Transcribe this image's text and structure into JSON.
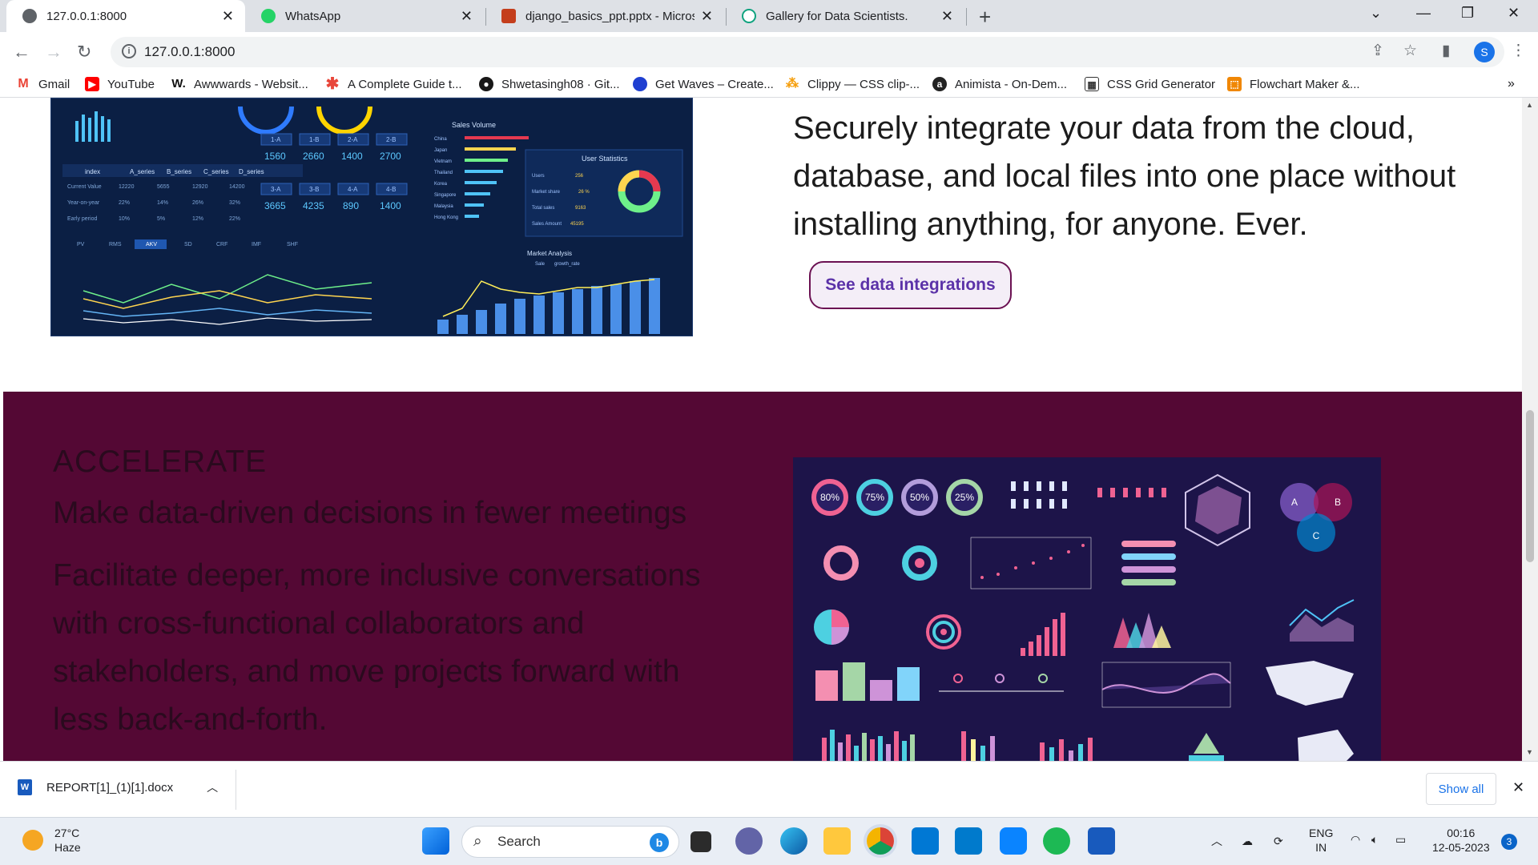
{
  "browser": {
    "tabs": [
      {
        "title": "127.0.0.1:8000",
        "active": true,
        "icon": "globe-icon"
      },
      {
        "title": "WhatsApp",
        "active": false,
        "icon": "whatsapp-icon"
      },
      {
        "title": "django_basics_ppt.pptx - Microsc",
        "active": false,
        "icon": "powerpoint-icon"
      },
      {
        "title": "Gallery for Data Scientists.",
        "active": false,
        "icon": "openai-icon"
      }
    ],
    "url": "127.0.0.1:8000",
    "profile_initial": "S",
    "bookmarks": [
      {
        "label": "Gmail",
        "icon": "gmail-icon"
      },
      {
        "label": "YouTube",
        "icon": "youtube-icon"
      },
      {
        "label": "Awwwards - Websit...",
        "icon": "awwwards-icon"
      },
      {
        "label": "A Complete Guide t...",
        "icon": "asterisk-icon"
      },
      {
        "label": "Shwetasingh08 · Git...",
        "icon": "github-icon"
      },
      {
        "label": "Get Waves – Create...",
        "icon": "waves-icon"
      },
      {
        "label": "Clippy — CSS clip-...",
        "icon": "clippy-icon"
      },
      {
        "label": "Animista - On-Dem...",
        "icon": "animista-icon"
      },
      {
        "label": "CSS Grid Generator",
        "icon": "grid-icon"
      },
      {
        "label": "Flowchart Maker &...",
        "icon": "flowchart-icon"
      }
    ]
  },
  "page": {
    "hero_text": "Securely integrate your data from the cloud, database, and local files into one place without installing anything, for anyone. Ever.",
    "cta_label": "See data integrations",
    "dashboard1": {
      "table_headers": [
        "index",
        "A_series",
        "B_series",
        "C_series",
        "D_series"
      ],
      "table_rows": [
        [
          "Current Value",
          "12220",
          "5655",
          "12920",
          "14200"
        ],
        [
          "Year-on-year",
          "22%",
          "14%",
          "26%",
          "32%"
        ],
        [
          "Early period",
          "10%",
          "5%",
          "12%",
          "22%"
        ]
      ],
      "tiles": [
        {
          "label": "1-A",
          "value": "1560"
        },
        {
          "label": "1-B",
          "value": "2660"
        },
        {
          "label": "2-A",
          "value": "1400"
        },
        {
          "label": "2-B",
          "value": "2700"
        },
        {
          "label": "3-A",
          "value": "3665"
        },
        {
          "label": "3-B",
          "value": "4235"
        },
        {
          "label": "4-A",
          "value": "890"
        },
        {
          "label": "4-B",
          "value": "1400"
        }
      ],
      "tabs": [
        "PV",
        "RMS",
        "AKV",
        "SD",
        "CRF",
        "IMF",
        "SHF"
      ],
      "sales_volume_title": "Sales Volume",
      "sales_countries": [
        "China",
        "Japan",
        "Vietnam",
        "Thailand",
        "Korea",
        "Singapore",
        "Malaysia",
        "Hong Kong"
      ],
      "user_stats_title": "User Statistics",
      "user_stats": [
        {
          "label": "Users",
          "value": "256"
        },
        {
          "label": "Market share",
          "value": "26 %"
        },
        {
          "label": "Total sales",
          "value": "9163"
        },
        {
          "label": "Sales Amount",
          "value": "45195"
        }
      ],
      "market_title": "Market Analysis",
      "market_legend": [
        "Sale",
        "growth_rate"
      ]
    },
    "accelerate": {
      "eyebrow": "ACCELERATE",
      "title": "Make data-driven decisions in fewer meetings",
      "body": "Facilitate deeper, more inclusive conversations with cross-functional collaborators and stakeholders, and move projects forward with less back-and-forth."
    },
    "dashboard2": {
      "donut_labels": [
        "80%",
        "75%",
        "50%",
        "25%"
      ],
      "venn_labels": [
        "A",
        "B",
        "C"
      ]
    }
  },
  "downloads": {
    "file": "REPORT[1]_(1)[1].docx",
    "show_all": "Show all"
  },
  "taskbar": {
    "temperature": "27°C",
    "condition": "Haze",
    "search_placeholder": "Search",
    "lang": "ENG",
    "region": "IN",
    "time": "00:16",
    "date": "12-05-2023",
    "notifications": "3"
  }
}
